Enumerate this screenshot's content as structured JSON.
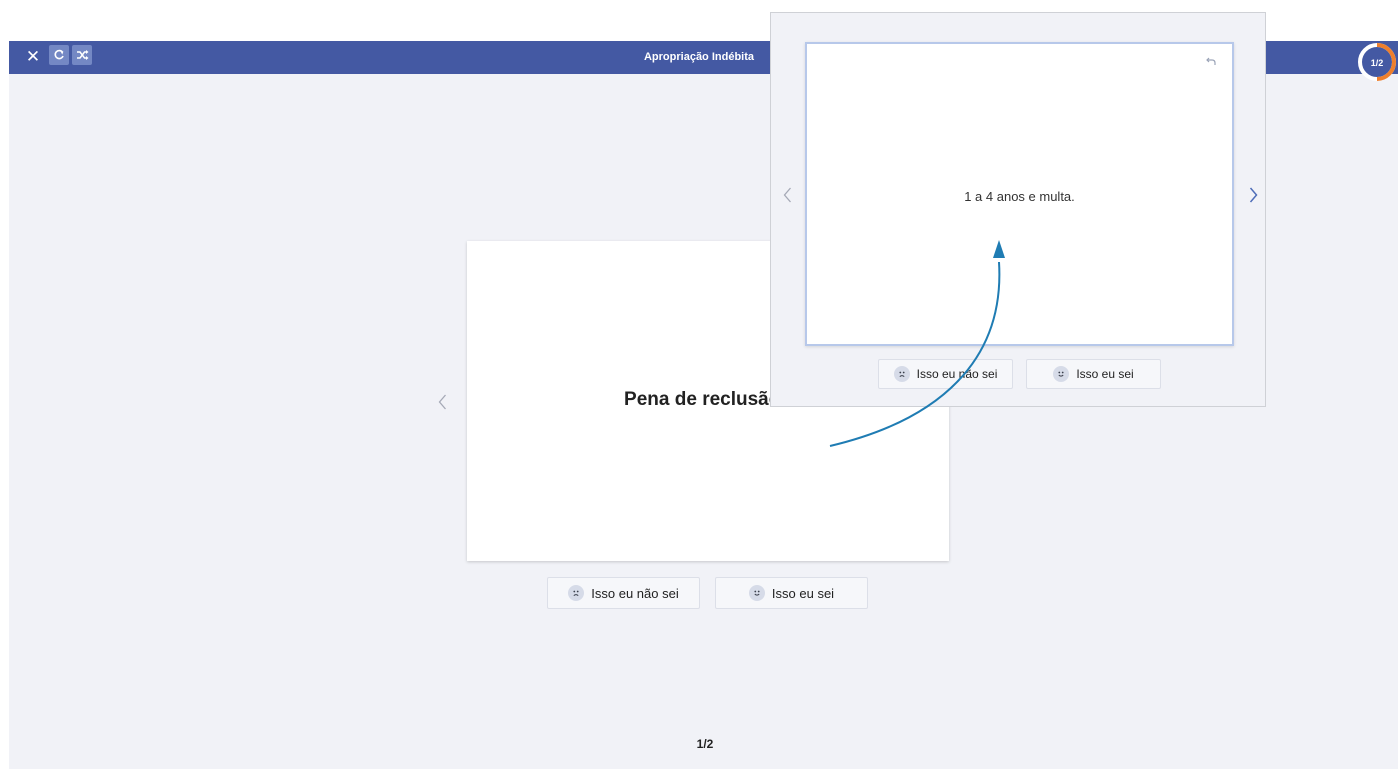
{
  "header": {
    "title": "Apropriação Indébita",
    "close_icon": "close-icon",
    "restart_icon": "restart-icon",
    "shuffle_icon": "shuffle-icon"
  },
  "progress": {
    "label": "1/2",
    "value": 0.5,
    "ring_color": "#ee7f2d"
  },
  "card": {
    "front_text": "Pena de reclusão?"
  },
  "answers": {
    "dont_know_label": "Isso eu não sei",
    "know_label": "Isso eu sei"
  },
  "counter": "1/2",
  "overlay": {
    "back_text": "1 a 4 anos e multa.",
    "dont_know_label": "Isso eu não sei",
    "know_label": "Isso eu sei"
  },
  "colors": {
    "header_bg": "#4459a3",
    "stage_bg": "#f1f2f7",
    "arrow": "#1f7cb3",
    "nav_active": "#4f6db8"
  }
}
